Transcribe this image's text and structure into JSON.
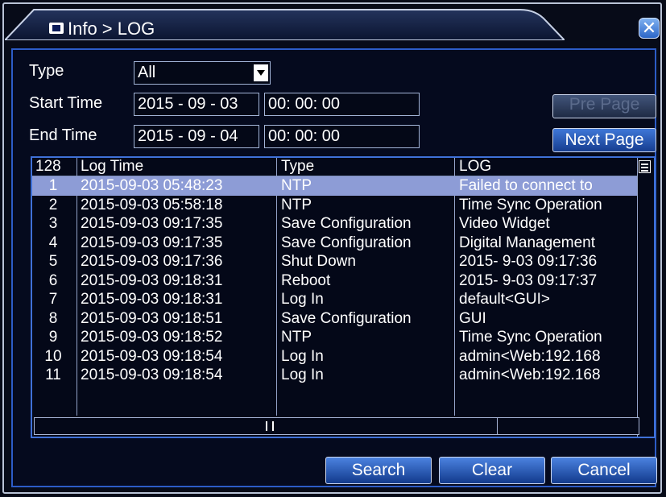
{
  "window": {
    "title": "Info > LOG",
    "close_glyph": "✕"
  },
  "filters": {
    "type_label": "Type",
    "type_value": "All",
    "start_label": "Start Time",
    "start_date": "2015 - 09 - 03",
    "start_time": "00: 00: 00",
    "end_label": "End Time",
    "end_date": "2015 - 09 - 04",
    "end_time": "00: 00: 00"
  },
  "paging": {
    "pre_label": "Pre Page",
    "next_label": "Next Page"
  },
  "table": {
    "headers": {
      "count": "128",
      "time": "Log Time",
      "type": "Type",
      "log": "LOG"
    },
    "rows": [
      {
        "num": "1",
        "time": "2015-09-03 05:48:23",
        "type": "NTP",
        "log": "Failed to connect to"
      },
      {
        "num": "2",
        "time": "2015-09-03 05:58:18",
        "type": "NTP",
        "log": "Time Sync Operation"
      },
      {
        "num": "3",
        "time": "2015-09-03 09:17:35",
        "type": "Save Configuration",
        "log": "Video Widget"
      },
      {
        "num": "4",
        "time": "2015-09-03 09:17:35",
        "type": "Save Configuration",
        "log": "Digital Management"
      },
      {
        "num": "5",
        "time": "2015-09-03 09:17:36",
        "type": "Shut Down",
        "log": "2015- 9-03 09:17:36"
      },
      {
        "num": "6",
        "time": "2015-09-03 09:18:31",
        "type": "Reboot",
        "log": "2015- 9-03 09:17:37"
      },
      {
        "num": "7",
        "time": "2015-09-03 09:18:31",
        "type": "Log In",
        "log": "default<GUI>"
      },
      {
        "num": "8",
        "time": "2015-09-03 09:18:51",
        "type": "Save Configuration",
        "log": "GUI"
      },
      {
        "num": "9",
        "time": "2015-09-03 09:18:52",
        "type": "NTP",
        "log": "Time Sync Operation"
      },
      {
        "num": "10",
        "time": "2015-09-03 09:18:54",
        "type": "Log In",
        "log": "admin<Web:192.168"
      },
      {
        "num": "11",
        "time": "2015-09-03 09:18:54",
        "type": "Log In",
        "log": "admin<Web:192.168"
      }
    ],
    "selected_row": 0
  },
  "actions": {
    "search_label": "Search",
    "clear_label": "Clear",
    "cancel_label": "Cancel"
  },
  "colors": {
    "accent_border": "#2c5cc7",
    "selected_row": "#8d9cd6",
    "button_blue": "#3f77d8"
  }
}
